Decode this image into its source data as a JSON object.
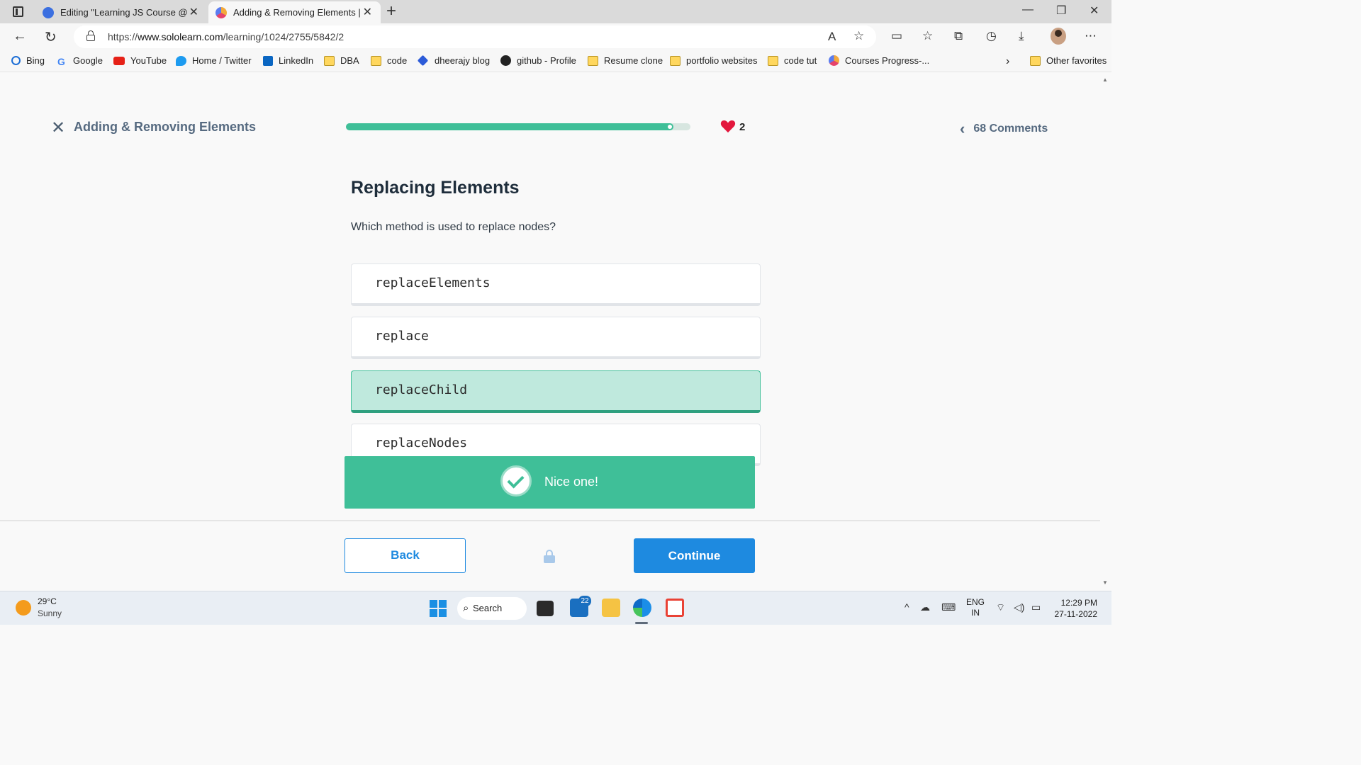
{
  "browser": {
    "tabs": [
      {
        "title": "Editing \"Learning JS Course @Sc",
        "active": false
      },
      {
        "title": "Adding & Removing Elements | S",
        "active": true
      }
    ],
    "url_prefix": "https://",
    "url_host": "www.sololearn.com",
    "url_path": "/learning/1024/2755/5842/2",
    "favorites": [
      {
        "label": "Bing",
        "icon": "bing-search-icon"
      },
      {
        "label": "Google",
        "icon": "google-icon"
      },
      {
        "label": "YouTube",
        "icon": "youtube-icon"
      },
      {
        "label": "Home / Twitter",
        "icon": "twitter-icon"
      },
      {
        "label": "LinkedIn",
        "icon": "linkedin-icon"
      },
      {
        "label": "DBA",
        "icon": "folder-icon"
      },
      {
        "label": "code",
        "icon": "folder-icon"
      },
      {
        "label": "dheerajy blog",
        "icon": "blog-icon"
      },
      {
        "label": "github - Profile",
        "icon": "github-icon"
      },
      {
        "label": "Resume clone",
        "icon": "folder-icon"
      },
      {
        "label": "portfolio websites",
        "icon": "folder-icon"
      },
      {
        "label": "code tut",
        "icon": "folder-icon"
      },
      {
        "label": "Courses Progress-...",
        "icon": "sololearn-icon"
      }
    ],
    "other_favorites": "Other favorites"
  },
  "lesson": {
    "title": "Adding & Removing Elements",
    "progress_fraction": 0.95,
    "hearts": "2",
    "comments": "68 Comments"
  },
  "question": {
    "title": "Replacing Elements",
    "text": "Which method is used to replace nodes?",
    "options": [
      {
        "label": "replaceElements",
        "selected": false
      },
      {
        "label": "replace",
        "selected": false
      },
      {
        "label": "replaceChild",
        "selected": true
      },
      {
        "label": "replaceNodes",
        "selected": false
      }
    ]
  },
  "feedback": {
    "message": "Nice one!"
  },
  "footer": {
    "back_label": "Back",
    "continue_label": "Continue"
  },
  "taskbar": {
    "weather_temp": "29°C",
    "weather_desc": "Sunny",
    "search_label": "Search",
    "mail_badge": "22",
    "lang_top": "ENG",
    "lang_bottom": "IN",
    "time": "12:29 PM",
    "date": "27-11-2022"
  },
  "colors": {
    "accent_green": "#3fbf98",
    "selected_bg": "#bfe9dd",
    "primary_blue": "#1e8ae0",
    "heart_red": "#e3173d"
  }
}
